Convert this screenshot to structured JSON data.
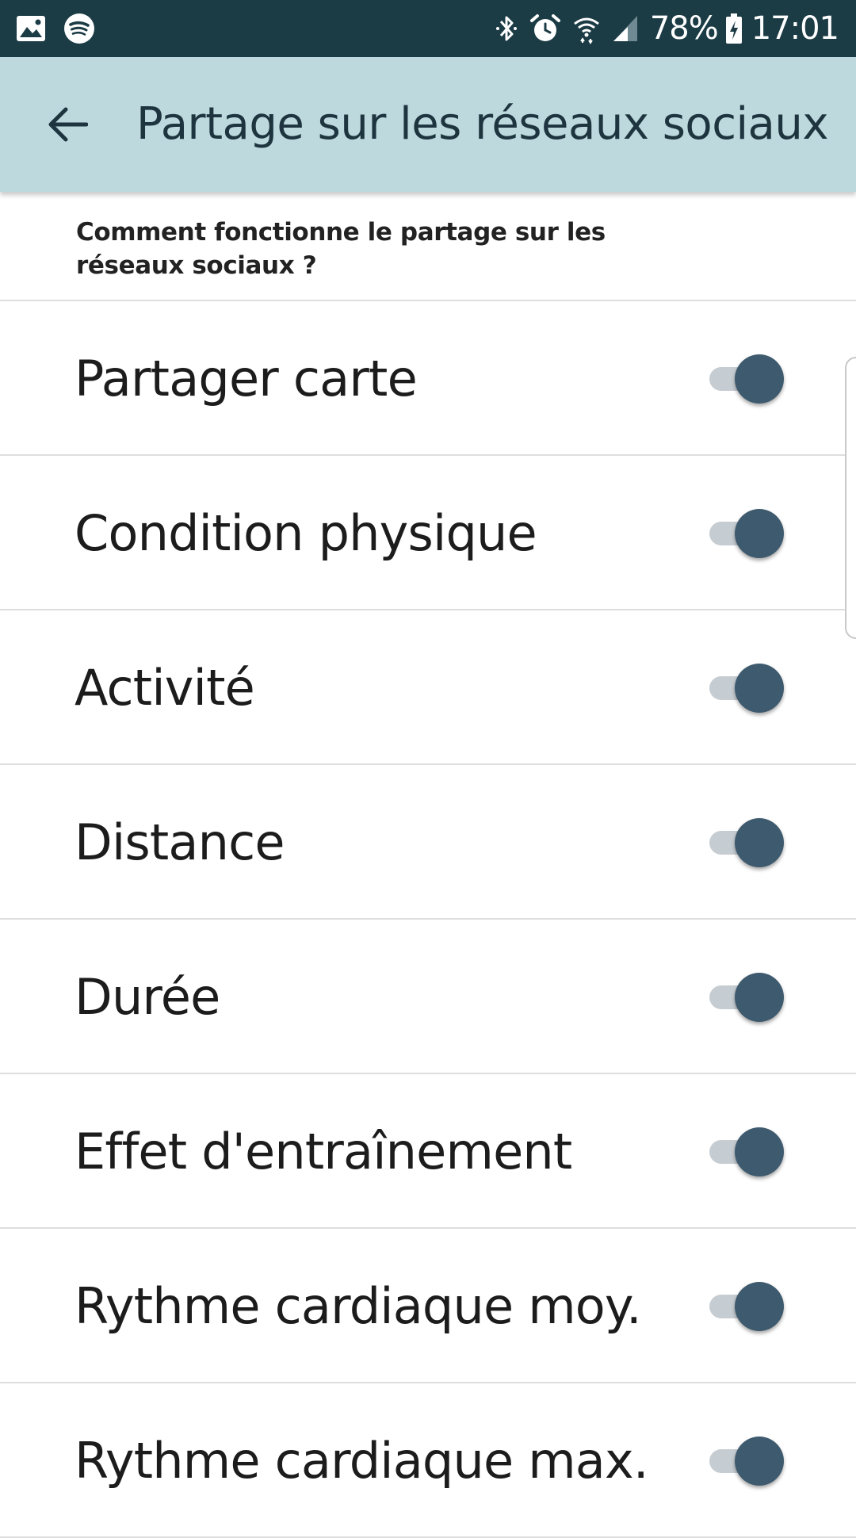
{
  "status_bar": {
    "left_icons": [
      "gallery-icon",
      "spotify-icon"
    ],
    "right_icons": [
      "bluetooth-icon",
      "alarm-icon",
      "wifi-icon",
      "signal-icon"
    ],
    "battery_percent": "78%",
    "time": "17:01"
  },
  "app_bar": {
    "back_icon": "arrow-left-icon",
    "title": "Partage sur les réseaux sociaux"
  },
  "info": {
    "text": "Comment fonctionne le partage sur les réseaux sociaux ?"
  },
  "settings": [
    {
      "label": "Partager carte",
      "enabled": true
    },
    {
      "label": "Condition physique",
      "enabled": true
    },
    {
      "label": "Activité",
      "enabled": true
    },
    {
      "label": "Distance",
      "enabled": true
    },
    {
      "label": "Durée",
      "enabled": true
    },
    {
      "label": "Effet d'entraînement",
      "enabled": true
    },
    {
      "label": "Rythme cardiaque moy.",
      "enabled": true
    },
    {
      "label": "Rythme cardiaque max.",
      "enabled": true
    }
  ],
  "colors": {
    "status_bar": "#1b3b45",
    "app_bar": "#bdd9dd",
    "toggle_thumb": "#3e5a6e",
    "toggle_track": "#c6cdd2",
    "divider": "#dedede"
  }
}
